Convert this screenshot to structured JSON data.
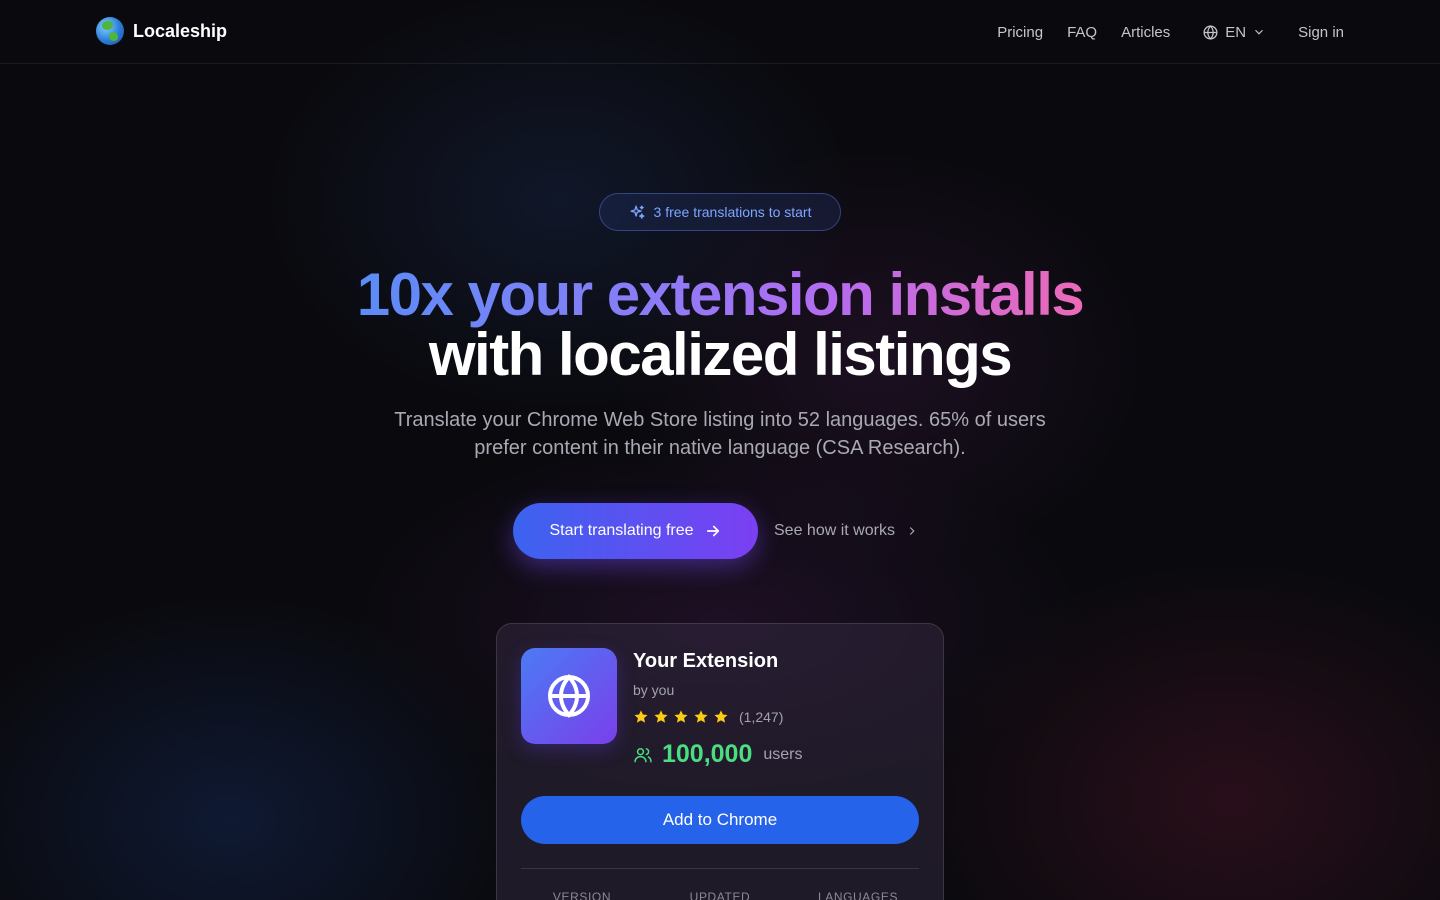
{
  "brand": {
    "name": "Localeship",
    "logo_icon": "earth-globe-icon"
  },
  "nav": {
    "links": [
      "Pricing",
      "FAQ",
      "Articles"
    ],
    "language": "EN",
    "signin": "Sign in"
  },
  "hero": {
    "badge": "3 free translations to start",
    "title_line1": "10x your extension installs",
    "title_line2": "with localized listings",
    "subtitle": "Translate your Chrome Web Store listing into 52 languages. 65% of users prefer content in their native language (CSA Research).",
    "cta_primary": "Start translating free",
    "cta_secondary": "See how it works"
  },
  "card": {
    "name": "Your Extension",
    "author": "by you",
    "rating_stars": 5,
    "rating_count": "(1,247)",
    "users_count": "100,000",
    "users_label": "users",
    "add_button": "Add to Chrome",
    "meta_labels": [
      "VERSION",
      "UPDATED",
      "LANGUAGES"
    ]
  },
  "colors": {
    "accent_blue": "#2563eb",
    "users_green": "#4ade80",
    "star_yellow": "#facc15",
    "badge_text": "#7ea6ff"
  }
}
